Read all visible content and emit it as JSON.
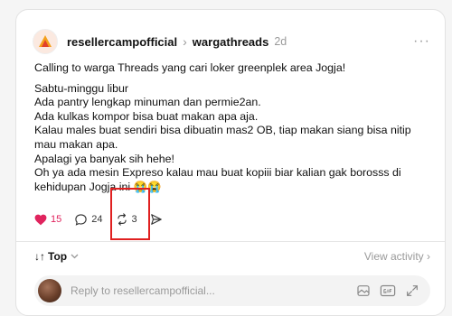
{
  "post": {
    "username": "resellercampofficial",
    "separator": "›",
    "topic": "wargathreads",
    "time": "2d",
    "more": "···",
    "paragraphs": [
      "Calling to warga Threads yang cari loker greenplek area Jogja!",
      "Sabtu-minggu libur",
      "Ada pantry lengkap minuman dan permie2an.",
      "Ada kulkas kompor bisa buat makan apa aja.",
      "Kalau males buat sendiri bisa dibuatin mas2 OB, tiap makan siang bisa nitip mau makan apa.",
      "Apalagi ya banyak sih hehe!",
      "Oh ya ada mesin Expreso kalau mau buat kopiii biar kalian gak borosss di kehidupan Jogja ini 😭😭"
    ]
  },
  "actions": {
    "likes": "15",
    "replies": "24",
    "reposts": "3"
  },
  "sort": {
    "arrows": "↓↑",
    "label": "Top",
    "view_activity": "View activity ›"
  },
  "reply": {
    "placeholder": "Reply to resellercampofficial..."
  },
  "icons": {
    "heart": "heart-icon",
    "comment": "comment-icon",
    "repost": "repost-icon",
    "share": "share-icon",
    "image": "image-icon",
    "gif": "gif-icon",
    "expand": "expand-icon"
  },
  "colors": {
    "like": "#e0245e",
    "highlight": "#e02020"
  }
}
